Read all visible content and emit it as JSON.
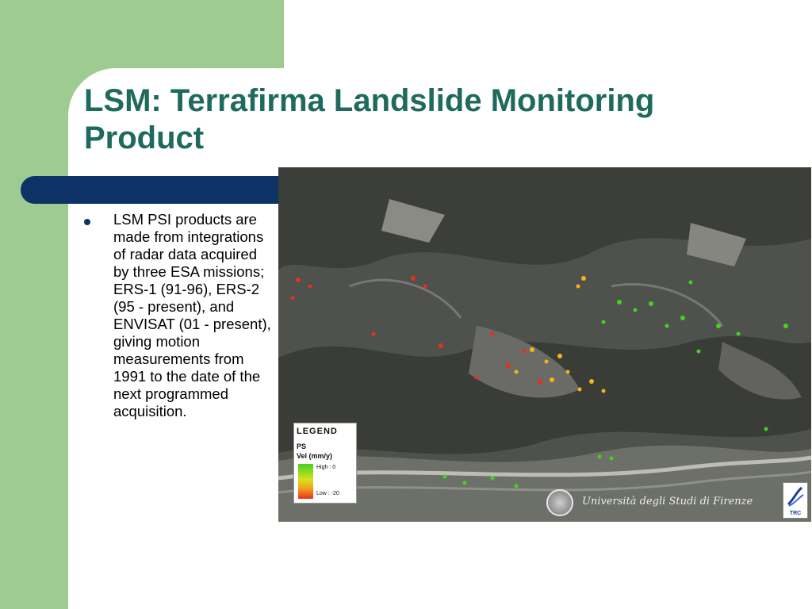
{
  "slide": {
    "title": "LSM: Terrafirma Landslide Monitoring Product",
    "bullet": "LSM PSI products are made from integrations of radar data acquired by three ESA missions; ERS-1 (91-96), ERS-2 (95 - present), and ENVISAT (01 - present), giving motion measurements from 1991 to the date of the next programmed acquisition."
  },
  "figure": {
    "legend": {
      "title": "LEGEND",
      "ps": "PS",
      "vel": "Vel (mm/y)",
      "high": "High : 0",
      "low": "Low : -20"
    },
    "university_name": "Università degli Studi di Firenze",
    "logo_text": "TRC",
    "colors": {
      "high": "#44d126",
      "mid": "#f2b41a",
      "low": "#e8301c"
    }
  },
  "colors": {
    "accent_green": "#9ecb92",
    "navy_bar": "#0d3366",
    "title": "#1e6b5e"
  }
}
